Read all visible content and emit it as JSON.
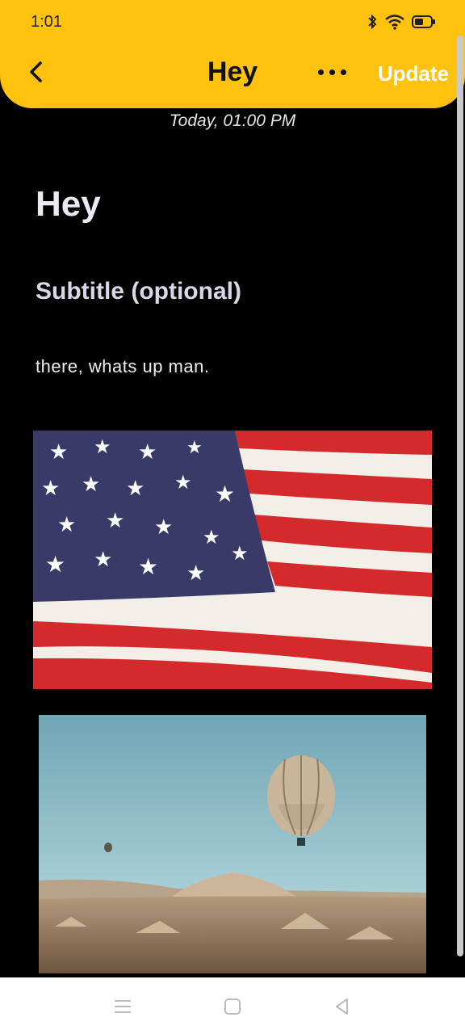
{
  "status_bar": {
    "time": "1:01"
  },
  "header": {
    "title": "Hey",
    "update_label": "Update"
  },
  "note": {
    "timestamp": "Today, 01:00 PM",
    "heading": "Hey",
    "subtitle": "Subtitle (optional)",
    "body": "there, whats up man."
  },
  "images": [
    {
      "name": "american-flag"
    },
    {
      "name": "hot-air-balloon-landscape"
    }
  ],
  "colors": {
    "header": "#ffc20e",
    "background": "#000000",
    "update_text": "#ffffff"
  }
}
